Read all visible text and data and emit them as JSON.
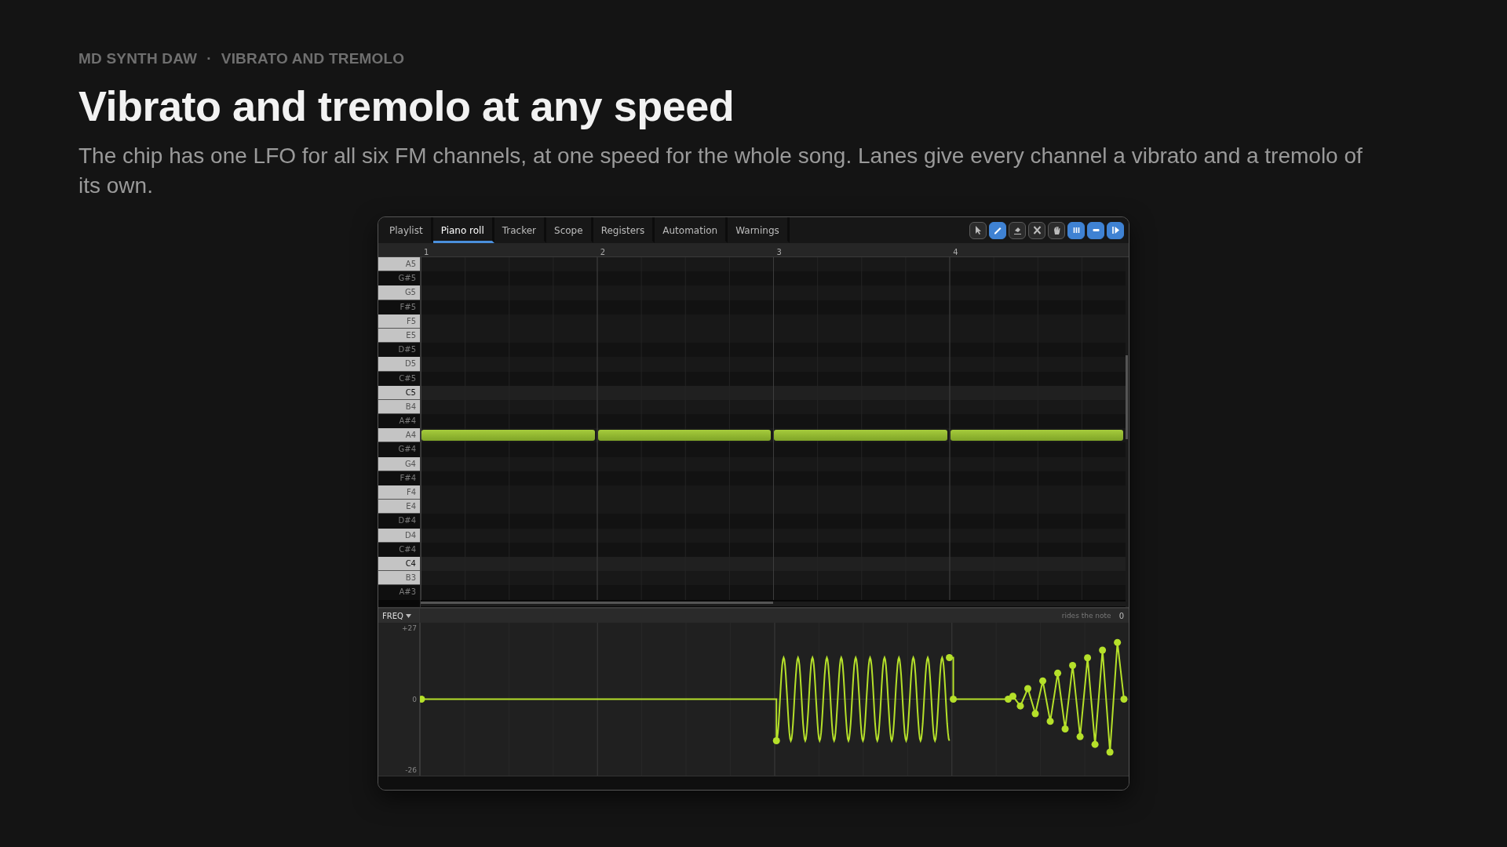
{
  "header": {
    "eyebrow": [
      "MD SYNTH DAW",
      "VIBRATO AND TREMOLO"
    ],
    "separator": "·",
    "title": "Vibrato and tremolo at any speed",
    "subtitle": "The chip has one LFO for all six FM channels, at one speed for the whole song. Lanes give every channel a vibrato and a tremolo of its own."
  },
  "window": {
    "tabs": [
      {
        "label": "Playlist",
        "selected": false
      },
      {
        "label": "Piano roll",
        "selected": true
      },
      {
        "label": "Tracker",
        "selected": false
      },
      {
        "label": "Scope",
        "selected": false
      },
      {
        "label": "Registers",
        "selected": false
      },
      {
        "label": "Automation",
        "selected": false
      },
      {
        "label": "Warnings",
        "selected": false
      }
    ],
    "tools": [
      {
        "kind": "pointer",
        "selected": false
      },
      {
        "kind": "pencil",
        "selected": true
      },
      {
        "kind": "eraser",
        "selected": false
      },
      {
        "kind": "cut",
        "selected": false
      },
      {
        "kind": "hand",
        "selected": false
      },
      {
        "kind": "bars",
        "selected": true
      },
      {
        "kind": "dash",
        "selected": true
      },
      {
        "kind": "step",
        "selected": true
      }
    ],
    "ruler": [
      "1",
      "2",
      "3",
      "4"
    ],
    "keys": [
      {
        "label": "A5",
        "kind": "white",
        "held": false
      },
      {
        "label": "G#5",
        "kind": "black",
        "held": false
      },
      {
        "label": "G5",
        "kind": "white",
        "held": false
      },
      {
        "label": "F#5",
        "kind": "black",
        "held": false
      },
      {
        "label": "F5",
        "kind": "white",
        "held": false
      },
      {
        "label": "E5",
        "kind": "white",
        "held": false
      },
      {
        "label": "D#5",
        "kind": "black",
        "held": false
      },
      {
        "label": "D5",
        "kind": "white",
        "held": false
      },
      {
        "label": "C#5",
        "kind": "black",
        "held": false
      },
      {
        "label": "C5",
        "kind": "octave",
        "held": false
      },
      {
        "label": "B4",
        "kind": "white",
        "held": false
      },
      {
        "label": "A#4",
        "kind": "black",
        "held": false
      },
      {
        "label": "A4",
        "kind": "white",
        "held": true
      },
      {
        "label": "G#4",
        "kind": "black",
        "held": false
      },
      {
        "label": "G4",
        "kind": "white",
        "held": false
      },
      {
        "label": "F#4",
        "kind": "black",
        "held": false
      },
      {
        "label": "F4",
        "kind": "white",
        "held": false
      },
      {
        "label": "E4",
        "kind": "white",
        "held": false
      },
      {
        "label": "D#4",
        "kind": "black",
        "held": false
      },
      {
        "label": "D4",
        "kind": "white",
        "held": false
      },
      {
        "label": "C#4",
        "kind": "black",
        "held": false
      },
      {
        "label": "C4",
        "kind": "octave",
        "held": false
      },
      {
        "label": "B3",
        "kind": "white",
        "held": false
      },
      {
        "label": "A#3",
        "kind": "black",
        "held": false
      }
    ],
    "automation": {
      "parameter": "FREQ",
      "mode": "rides the note",
      "value": "0",
      "scale": [
        "+27",
        "0",
        "-26"
      ]
    }
  }
}
